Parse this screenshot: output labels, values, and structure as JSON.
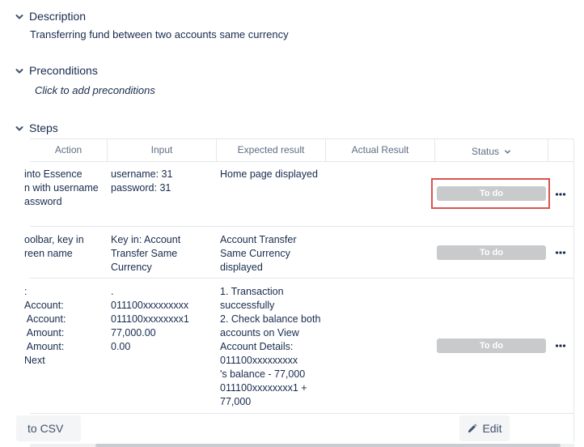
{
  "sections": {
    "description": {
      "title": "Description",
      "text": "Transferring fund between two accounts same currency"
    },
    "preconditions": {
      "title": "Preconditions",
      "text": "Click to add preconditions"
    },
    "steps": {
      "title": "Steps"
    }
  },
  "table": {
    "headers": {
      "action": "Action",
      "input": "Input",
      "expected": "Expected result",
      "actual": "Actual Result",
      "status": "Status"
    },
    "rows": [
      {
        "action": "into Essence\nn with username\nassword",
        "input": "username: 31\npassword: 31",
        "expected": "Home page displayed",
        "actual": "",
        "status": "To do"
      },
      {
        "action": "oolbar, key in\nreen name",
        "input": "Key in: Account\nTransfer Same\nCurrency",
        "expected": "Account Transfer\nSame Currency\ndisplayed",
        "actual": "",
        "status": "To do"
      },
      {
        "action": ":\nAccount:\n Account:\n Amount:\n Amount:\nNext",
        "input": ".\n011100xxxxxxxxx\n011100xxxxxxxx1\n77,000.00\n0.00",
        "expected": "1. Transaction\nsuccessfully\n2. Check balance both\naccounts on View\nAccount Details:\n011100xxxxxxxxx\n's balance - 77,000\n011100xxxxxxxx1 +\n77,000",
        "actual": "",
        "status": "To do"
      }
    ]
  },
  "footer": {
    "export_label": "to CSV",
    "edit_label": "Edit"
  },
  "colors": {
    "status_pill": "#c9cacc",
    "highlight": "#d9534f"
  },
  "icons": {
    "section_toggle": "chevron-down-icon",
    "status_sort": "chevron-down-icon",
    "row_menu": "more-icon",
    "edit": "pencil-icon"
  }
}
